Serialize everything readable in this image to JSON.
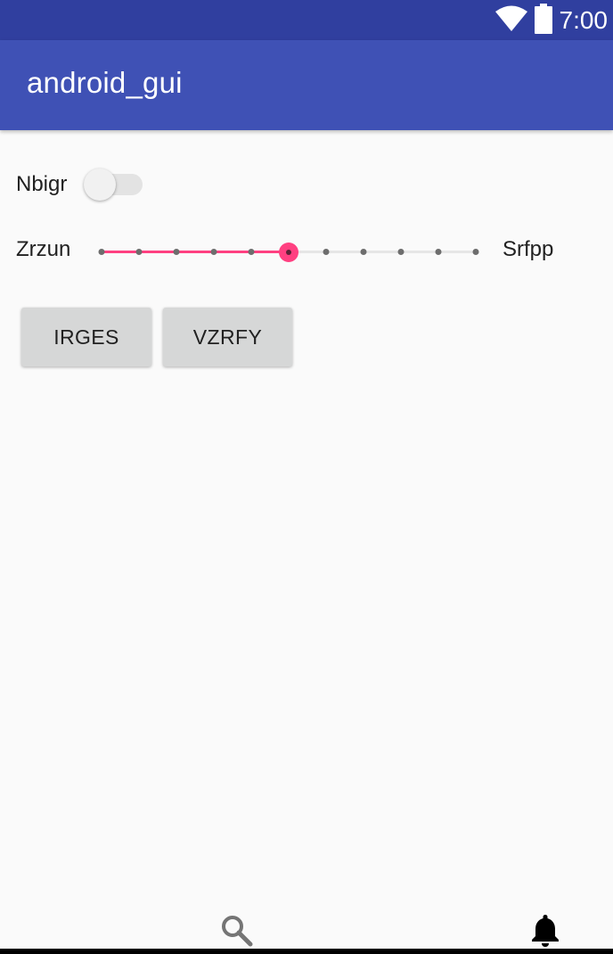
{
  "status_bar": {
    "time": "7:00",
    "icons": [
      "wifi-icon",
      "battery-icon"
    ]
  },
  "app_bar": {
    "title": "android_gui"
  },
  "switch": {
    "label": "Nbigr",
    "checked": false
  },
  "slider": {
    "left_label": "Zrzun",
    "right_label": "Srfpp",
    "steps": 10,
    "value": 5,
    "accent_color": "#ff4081"
  },
  "buttons": {
    "first_label": "IRGES",
    "second_label": "VZRFY"
  },
  "bottom_nav": {
    "items": [
      "search-icon",
      "bell-icon"
    ]
  },
  "colors": {
    "status_bar": "#303f9f",
    "app_bar": "#3f51b5",
    "background": "#fafafa",
    "button": "#d6d7d7",
    "accent": "#ff4081"
  }
}
